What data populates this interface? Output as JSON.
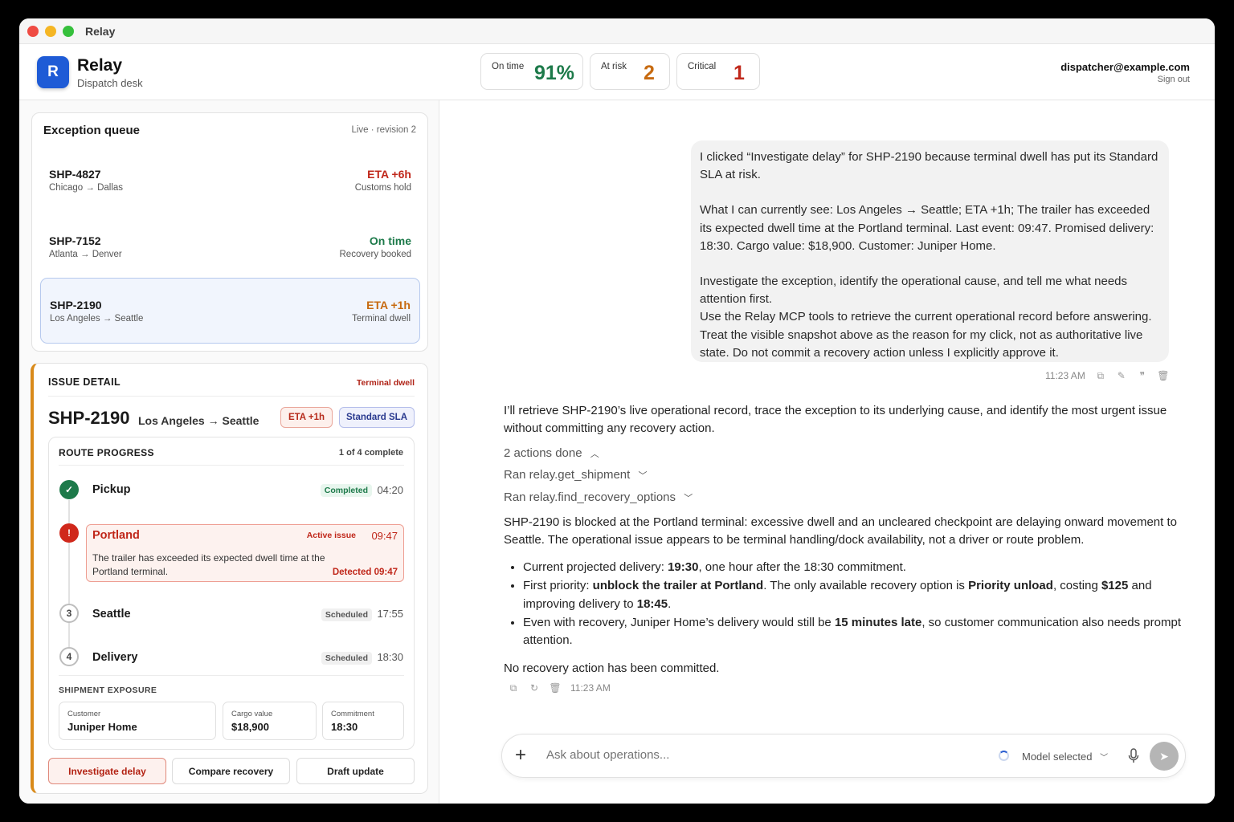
{
  "window": {
    "title": "Relay"
  },
  "header": {
    "logo_letter": "R",
    "brand": "Relay",
    "subtitle": "Dispatch desk",
    "kpis": [
      {
        "label": "On time",
        "value": "91%",
        "color": "#1d7a4a"
      },
      {
        "label": "At risk",
        "value": "2",
        "color": "#c76a10"
      },
      {
        "label": "Critical",
        "value": "1",
        "color": "#c0271a"
      }
    ],
    "user_email": "dispatcher@example.com",
    "sign_out": "Sign out"
  },
  "queue": {
    "title": "Exception queue",
    "meta": "Live · revision 2",
    "items": [
      {
        "id": "SHP-4827",
        "route": "Chicago → Dallas",
        "status": "ETA +6h",
        "status_color": "#c0271a",
        "sub": "Customs hold"
      },
      {
        "id": "SHP-7152",
        "route": "Atlanta → Denver",
        "status": "On time",
        "status_color": "#1d7a4a",
        "sub": "Recovery booked"
      },
      {
        "id": "SHP-2190",
        "route": "Los Angeles → Seattle",
        "status": "ETA +1h",
        "status_color": "#c76a10",
        "sub": "Terminal dwell"
      }
    ]
  },
  "detail": {
    "heading": "ISSUE DETAIL",
    "tag": "Terminal dwell",
    "shipment_id": "SHP-2190",
    "route": "Los Angeles → Seattle",
    "eta_pill": "ETA +1h",
    "sla_pill": "Standard SLA",
    "route_progress": {
      "heading": "ROUTE PROGRESS",
      "progress": "1 of 4 complete",
      "steps": [
        {
          "marker": "✓",
          "name": "Pickup",
          "badge": "Completed",
          "time": "04:20"
        },
        {
          "marker": "!",
          "name": "Portland",
          "badge": "Active issue",
          "time": "09:47",
          "description": "The trailer has exceeded its expected dwell time at the Portland terminal.",
          "detected": "Detected 09:47"
        },
        {
          "marker": "3",
          "name": "Seattle",
          "badge": "Scheduled",
          "time": "17:55"
        },
        {
          "marker": "4",
          "name": "Delivery",
          "badge": "Scheduled",
          "time": "18:30"
        }
      ]
    },
    "exposure": {
      "heading": "SHIPMENT EXPOSURE",
      "fields": [
        {
          "label": "Customer",
          "value": "Juniper Home"
        },
        {
          "label": "Cargo value",
          "value": "$18,900"
        },
        {
          "label": "Commitment",
          "value": "18:30"
        }
      ]
    },
    "actions": [
      "Investigate delay",
      "Compare recovery",
      "Draft update"
    ]
  },
  "chat": {
    "user_message": {
      "p1": "I clicked “Investigate delay” for SHP-2190 because terminal dwell has put its Standard SLA at risk.",
      "p2": "What I can currently see: Los Angeles → Seattle; ETA +1h; The trailer has exceeded its expected dwell time at the Portland terminal. Last event: 09:47. Promised delivery: 18:30. Cargo value: $18,900. Customer: Juniper Home.",
      "p3": "Investigate the exception, identify the operational cause, and tell me what needs attention first.",
      "p4": "Use the Relay MCP tools to retrieve the current operational record before answering. Treat the visible snapshot above as the reason for my click, not as authoritative live state. Do not commit a recovery action unless I explicitly approve it.",
      "time": "11:23 AM"
    },
    "assistant": {
      "intro": "I’ll retrieve SHP-2190’s live operational record, trace the exception to its underlying cause, and identify the most urgent issue without committing any recovery action.",
      "actions_done": "2 actions done",
      "tool_calls": [
        "Ran relay.get_shipment",
        "Ran relay.find_recovery_options"
      ],
      "finding": "SHP-2190 is blocked at the Portland terminal: excessive dwell and an uncleared checkpoint are delaying onward movement to Seattle. The operational issue appears to be terminal handling/dock availability, not a driver or route problem.",
      "bullets": [
        {
          "a": "Current projected delivery: ",
          "b": "19:30",
          "c": ", one hour after the 18:30 commitment."
        },
        {
          "a": "First priority: ",
          "b": "unblock the trailer at Portland",
          "c": ". The only available recovery option is ",
          "d": "Priority unload",
          "e": ", costing ",
          "f": "$125",
          "g": " and improving delivery to ",
          "h": "18:45",
          "i": "."
        },
        {
          "a": "Even with recovery, Juniper Home’s delivery would still be ",
          "b": "15 minutes late",
          "c": ", so customer communication also needs prompt attention."
        }
      ],
      "closing": "No recovery action has been committed.",
      "time": "11:23 AM"
    },
    "composer": {
      "placeholder": "Ask about operations...",
      "model": "Model selected"
    }
  }
}
